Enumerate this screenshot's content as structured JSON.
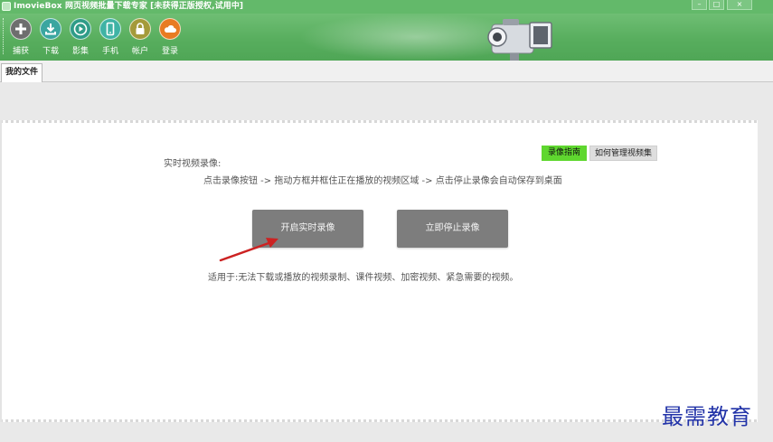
{
  "window": {
    "title": "ImovieBox 网页视频批量下载专家 [未获得正版授权,试用中]",
    "controls": [
      "–",
      "□",
      "×"
    ]
  },
  "toolbar": {
    "buttons": [
      {
        "label": "捕获",
        "icon": "plus-icon",
        "color": "#6e6e6e"
      },
      {
        "label": "下载",
        "icon": "download-icon",
        "color": "#3aa6a0"
      },
      {
        "label": "影集",
        "icon": "play-icon",
        "color": "#2f9c88"
      },
      {
        "label": "手机",
        "icon": "phone-icon",
        "color": "#3fb3a5"
      },
      {
        "label": "帐户",
        "icon": "lock-icon",
        "color": "#a49a3a"
      },
      {
        "label": "登录",
        "icon": "cloud-icon",
        "color": "#e87b22"
      }
    ]
  },
  "tabs": [
    {
      "label": "我的文件"
    }
  ],
  "main": {
    "guide_label": "录像指南",
    "manage_label": "如何管理视频集",
    "heading": "实时视频录像:",
    "instructions": "点击录像按钮 -> 拖动方框并框住正在播放的视频区域 -> 点击停止录像会自动保存到桌面",
    "start_label": "开启实时录像",
    "stop_label": "立即停止录像",
    "usage": "适用于:无法下载或播放的视频录制、课件视频、加密视频、紧急需要的视频。"
  },
  "watermark": "最需教育",
  "colors": {
    "titlebar": "#63b96a",
    "toolbar": "#58ae5e",
    "guide_button": "#5fd72f",
    "action_button": "#7d7d7d",
    "annotation_arrow": "#cc2222",
    "watermark": "#2233a8"
  }
}
